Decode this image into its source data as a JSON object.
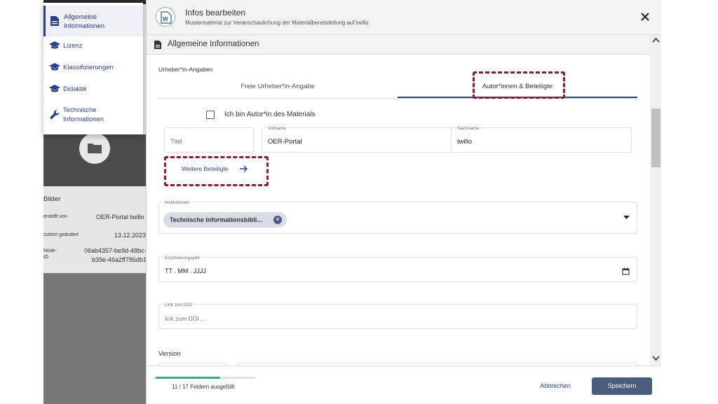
{
  "background": {
    "section_title": "Bilder",
    "meta": [
      {
        "key": "erstellt von",
        "value": "OER-Portal twillo"
      },
      {
        "key": "zuletzt geändert",
        "value": "13.12.2023"
      },
      {
        "key": "Node-",
        "key2": "ID",
        "value": "06ab4357-be9d-48bc-",
        "value2": "b39e-46a2ff786db1"
      }
    ]
  },
  "sidebar": {
    "items": [
      {
        "label": "Allgemeine",
        "label2": "Informationen",
        "icon": "document-icon",
        "active": true
      },
      {
        "label": "Lizenz",
        "icon": "graduation-cap-icon"
      },
      {
        "label": "Klassifizierungen",
        "icon": "graduation-cap-icon"
      },
      {
        "label": "Didaktik",
        "icon": "graduation-cap-icon"
      },
      {
        "label": "Technische",
        "label2": "Informationen",
        "icon": "wrench-icon"
      }
    ]
  },
  "dialog": {
    "title": "Infos bearbeiten",
    "subtitle": "Mustermaterial zur Veranschaulichung der Materialbereitstellung auf twillo",
    "section_title": "Allgemeine Informationen",
    "author_heading": "Urheber*in-Angaben",
    "tabs": [
      {
        "label": "Freie Urheber*in-Angabe",
        "active": false
      },
      {
        "label": "Autor*innen & Beteiligte",
        "active": true
      }
    ],
    "checkbox_label": "Ich bin Autor*in des Materials",
    "fields": {
      "titel": {
        "placeholder": "Titel"
      },
      "vorname": {
        "label": "Vorname",
        "value": "OER-Portal"
      },
      "nachname": {
        "label": "Nachname",
        "value": "twillo"
      },
      "institutionen": {
        "label": "Institutionen",
        "chip": "Technische Informationsbibli..."
      },
      "erscheinungsjahr": {
        "label": "Erscheinungsjahr",
        "value": "TT . MM . JJJJ"
      },
      "doi": {
        "label": "Link zum DOI",
        "placeholder": "link zum DOI ..."
      }
    },
    "more_link": "Weitere Beteiligte",
    "version_label": "Version",
    "footer": {
      "progress_fraction": 0.647,
      "progress_text": "11 / 17 Feldern ausgefüllt",
      "cancel_label": "Abbrechen",
      "save_label": "Speichern"
    }
  },
  "colors": {
    "accent": "#2b3f8a",
    "annotation": "#8e1b2b",
    "progress": "#3aa88f",
    "save_button": "#4a5d7e"
  }
}
